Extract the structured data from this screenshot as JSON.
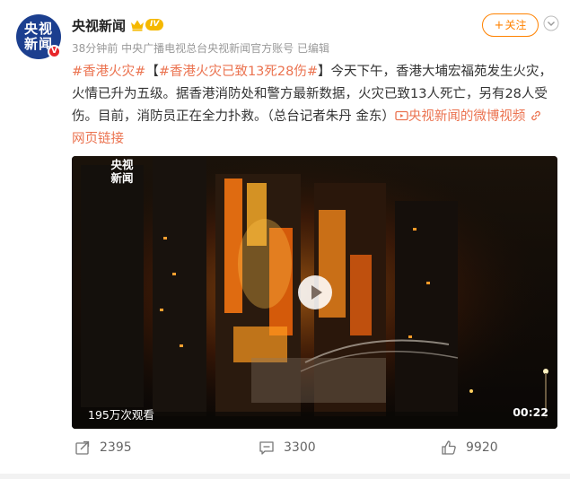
{
  "author": {
    "name": "央视新闻",
    "avatar_lines": [
      "央视",
      "新闻"
    ],
    "verified_mark": "V",
    "level_badge": "IV",
    "crown_icon": "crown-icon"
  },
  "meta": {
    "time": "38分钟前",
    "source": "中央广播电视总台央视新闻官方账号",
    "edited": "已编辑"
  },
  "header": {
    "follow_label": "关注",
    "follow_plus": "+",
    "more_icon": "chevron-down-icon"
  },
  "content": {
    "hashtag1": "#香港火灾#",
    "bracket_open": "【",
    "hashtag2": "#香港火灾已致13死28伤#",
    "bracket_close": "】",
    "body": "今天下午，香港大埔宏福苑发生火灾，火情已升为五级。据香港消防处和警方最新数据，火灾已致13人死亡，另有28人受伤。目前，消防员正在全力扑救。（总台记者朱丹 金东）",
    "video_link": "央视新闻的微博视频",
    "web_link": "网页链接"
  },
  "video": {
    "watermark_lines": [
      "央视",
      "新闻"
    ],
    "views": "195万次观看",
    "duration": "00:22",
    "play_icon": "play-icon"
  },
  "actions": {
    "repost": "2395",
    "comment": "3300",
    "like": "9920"
  },
  "colors": {
    "accent": "#ff8200",
    "link": "#eb7350",
    "verified": "#e8262a",
    "avatar_bg": "#1c3f8f"
  }
}
